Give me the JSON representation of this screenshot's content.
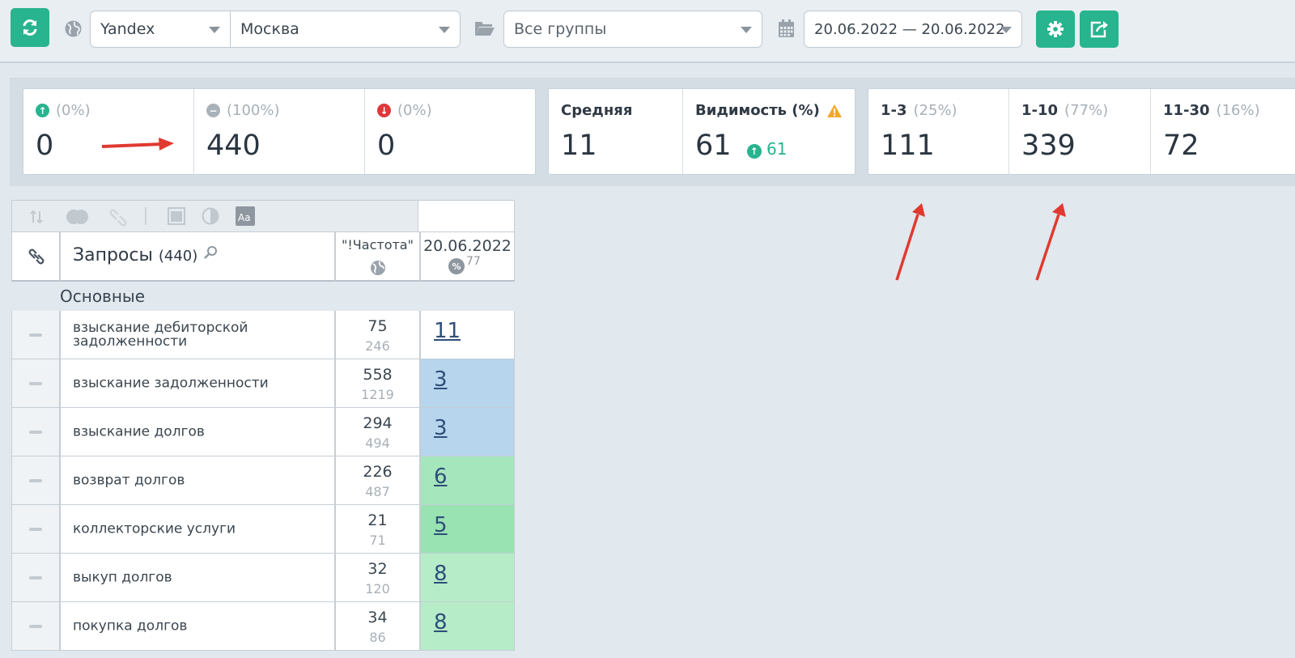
{
  "toolbar": {
    "engine": "Yandex",
    "region": "Москва",
    "group": "Все группы",
    "date_range": "20.06.2022 — 20.06.2022",
    "icons": [
      "refresh-icon",
      "globe-icon",
      "folder-icon",
      "calendar-icon",
      "gear-icon",
      "export-icon"
    ]
  },
  "stats": {
    "up": {
      "pct": "(0%)",
      "value": "0"
    },
    "same": {
      "pct": "(100%)",
      "value": "440"
    },
    "down": {
      "pct": "(0%)",
      "value": "0"
    },
    "average": {
      "label": "Средняя",
      "value": "11"
    },
    "visibility": {
      "label": "Видимость (%)",
      "value": "61",
      "delta": "61"
    },
    "top3": {
      "label": "1-3",
      "pct": "(25%)",
      "value": "111"
    },
    "top10": {
      "label": "1-10",
      "pct": "(77%)",
      "value": "339"
    },
    "top30": {
      "label": "11-30",
      "pct": "(16%)",
      "value": "72"
    }
  },
  "table": {
    "queries_label": "Запросы",
    "queries_count": "(440)",
    "freq_header": "\"!Частота\"",
    "date_header": "20.06.2022",
    "date_sub": "77",
    "group_name": "Основные",
    "rows": [
      {
        "query": "взыскание дебиторской задолженности",
        "f1": "75",
        "f2": "246",
        "pos": "11",
        "color": "#ffffff"
      },
      {
        "query": "взыскание задолженности",
        "f1": "558",
        "f2": "1219",
        "pos": "3",
        "color": "#b7d6ee"
      },
      {
        "query": "взыскание долгов",
        "f1": "294",
        "f2": "494",
        "pos": "3",
        "color": "#b7d6ee"
      },
      {
        "query": "возврат долгов",
        "f1": "226",
        "f2": "487",
        "pos": "6",
        "color": "#a6e6bd"
      },
      {
        "query": "коллекторские услуги",
        "f1": "21",
        "f2": "71",
        "pos": "5",
        "color": "#99e2b2"
      },
      {
        "query": "выкуп долгов",
        "f1": "32",
        "f2": "120",
        "pos": "8",
        "color": "#b6ecc8"
      },
      {
        "query": "покупка долгов",
        "f1": "34",
        "f2": "86",
        "pos": "8",
        "color": "#b6ecc8"
      }
    ]
  },
  "colors": {
    "accent": "#27b48f",
    "down": "#e0373a",
    "warning": "#f0a830",
    "arrow": "#e03a30"
  }
}
